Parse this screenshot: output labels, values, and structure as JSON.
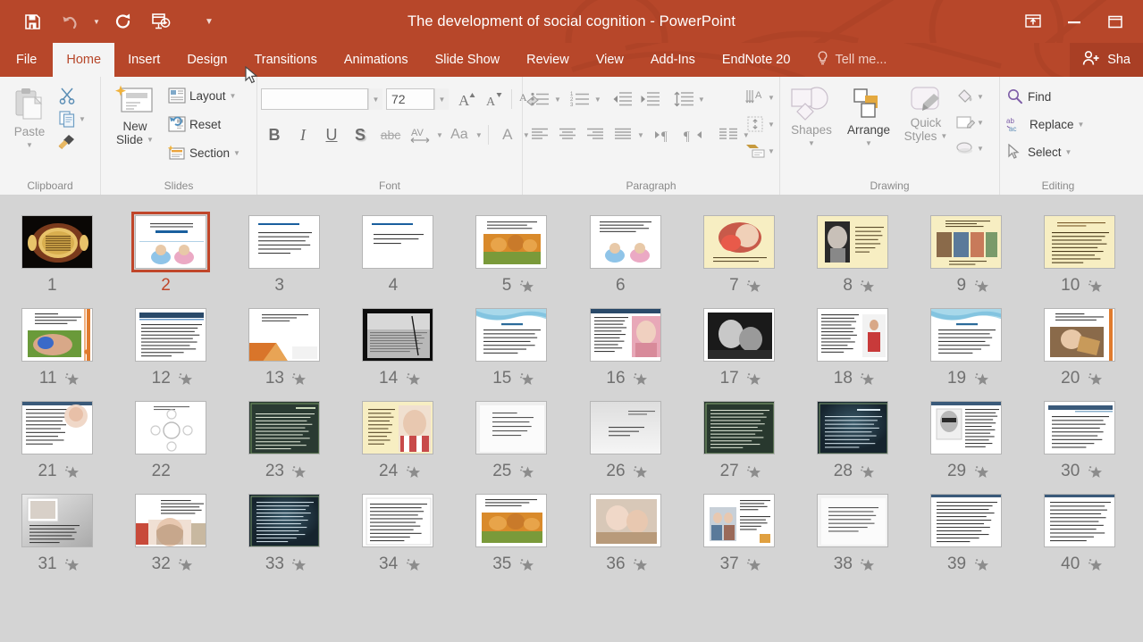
{
  "window": {
    "title": "The development of social cognition - PowerPoint",
    "accent_color": "#b7472a",
    "quick_access": [
      {
        "name": "save-icon",
        "label": "Save"
      },
      {
        "name": "undo-icon",
        "label": "Undo"
      },
      {
        "name": "redo-icon",
        "label": "Redo"
      },
      {
        "name": "start-presentation-icon",
        "label": "Start From Beginning"
      },
      {
        "name": "customize-quick-access-icon",
        "label": "Customize Quick Access Toolbar"
      }
    ],
    "controls": [
      {
        "name": "ribbon-display-options-icon",
        "label": "Ribbon Display Options"
      },
      {
        "name": "minimize-icon",
        "label": "Minimize"
      },
      {
        "name": "restore-icon",
        "label": "Restore Down"
      }
    ]
  },
  "tabs": [
    {
      "label": "File",
      "active": false
    },
    {
      "label": "Home",
      "active": true
    },
    {
      "label": "Insert",
      "active": false
    },
    {
      "label": "Design",
      "active": false
    },
    {
      "label": "Transitions",
      "active": false
    },
    {
      "label": "Animations",
      "active": false
    },
    {
      "label": "Slide Show",
      "active": false
    },
    {
      "label": "Review",
      "active": false
    },
    {
      "label": "View",
      "active": false
    },
    {
      "label": "Add-Ins",
      "active": false
    },
    {
      "label": "EndNote 20",
      "active": false
    }
  ],
  "tell_me": {
    "label": "Tell me...",
    "icon": "lightbulb-icon"
  },
  "share": {
    "label": "Sha",
    "icon": "share-person-icon"
  },
  "ribbon": {
    "clipboard": {
      "label": "Clipboard",
      "paste_label": "Paste",
      "cut_label": "Cut",
      "copy_label": "Copy",
      "format_painter_label": "Format Painter"
    },
    "slides": {
      "label": "Slides",
      "new_slide_label": "New\nSlide",
      "new_slide_line1": "New",
      "new_slide_line2": "Slide",
      "layout_label": "Layout",
      "reset_label": "Reset",
      "section_label": "Section"
    },
    "font": {
      "label": "Font",
      "font_name_value": "",
      "font_name_placeholder": "",
      "font_size_value": "72",
      "increase_font_label": "A",
      "decrease_font_label": "A",
      "clear_formatting_label": "A",
      "bold_label": "B",
      "italic_label": "I",
      "underline_label": "U",
      "shadow_label": "S",
      "strikethrough_label": "abc",
      "character_spacing_label": "AV",
      "change_case_label": "Aa",
      "font_color_label": "A"
    },
    "paragraph": {
      "label": "Paragraph",
      "bullets_label": "Bullets",
      "numbering_label": "Numbering",
      "decrease_indent_label": "Decrease List Level",
      "increase_indent_label": "Increase List Level",
      "line_spacing_label": "Line Spacing",
      "align_left_label": "Align Left",
      "center_label": "Center",
      "align_right_label": "Align Right",
      "justify_label": "Justify",
      "ltr_label": "Left-to-Right",
      "rtl_label": "Right-to-Left",
      "columns_label": "Columns",
      "text_direction_label": "Text Direction",
      "align_text_label": "Align Text",
      "smartart_label": "Convert to SmartArt"
    },
    "drawing": {
      "label": "Drawing",
      "shapes_label": "Shapes",
      "arrange_label": "Arrange",
      "quick_styles_line1": "Quick",
      "quick_styles_line2": "Styles",
      "shape_fill_label": "Shape Fill",
      "shape_outline_label": "Shape Outline",
      "shape_effects_label": "Shape Effects"
    },
    "editing": {
      "label": "Editing",
      "find_label": "Find",
      "replace_label": "Replace",
      "select_label": "Select"
    }
  },
  "slides_panel": {
    "selected_slide": 2,
    "background_color": "#d4d4d4",
    "selection_color": "#c0462a",
    "columns": 10,
    "slides": [
      {
        "n": "1",
        "animated": false,
        "style": "calligraphy-dark"
      },
      {
        "n": "2",
        "animated": false,
        "style": "title-babies",
        "selected": true
      },
      {
        "n": "3",
        "animated": false,
        "style": "text-white"
      },
      {
        "n": "4",
        "animated": false,
        "style": "text-white-short"
      },
      {
        "n": "5",
        "animated": true,
        "style": "text-photo-orange"
      },
      {
        "n": "6",
        "animated": false,
        "style": "text-babies"
      },
      {
        "n": "7",
        "animated": true,
        "style": "cream-oval-photo"
      },
      {
        "n": "8",
        "animated": true,
        "style": "cream-bw-photo"
      },
      {
        "n": "9",
        "animated": true,
        "style": "cream-collage"
      },
      {
        "n": "10",
        "animated": true,
        "style": "cream-text"
      },
      {
        "n": "11",
        "animated": true,
        "style": "orange-edge-photo"
      },
      {
        "n": "12",
        "animated": true,
        "style": "dark-header-text"
      },
      {
        "n": "13",
        "animated": true,
        "style": "orange-geometric"
      },
      {
        "n": "14",
        "animated": true,
        "style": "bw-full-photo"
      },
      {
        "n": "15",
        "animated": true,
        "style": "blue-wave-text"
      },
      {
        "n": "16",
        "animated": true,
        "style": "text-pink-photo"
      },
      {
        "n": "17",
        "animated": true,
        "style": "bw-photo-full"
      },
      {
        "n": "18",
        "animated": true,
        "style": "text-red-figure"
      },
      {
        "n": "19",
        "animated": true,
        "style": "blue-wave-text"
      },
      {
        "n": "20",
        "animated": true,
        "style": "orange-edge-photo2"
      },
      {
        "n": "21",
        "animated": true,
        "style": "text-circle-photo"
      },
      {
        "n": "22",
        "animated": false,
        "style": "diagram-light"
      },
      {
        "n": "23",
        "animated": true,
        "style": "dark-green-text"
      },
      {
        "n": "24",
        "animated": true,
        "style": "cream-child-photo"
      },
      {
        "n": "25",
        "animated": true,
        "style": "gray-text"
      },
      {
        "n": "26",
        "animated": true,
        "style": "gray-gradient"
      },
      {
        "n": "27",
        "animated": true,
        "style": "dark-green-text2"
      },
      {
        "n": "28",
        "animated": true,
        "style": "dark-teal-text"
      },
      {
        "n": "29",
        "animated": true,
        "style": "bw-portrait-text"
      },
      {
        "n": "30",
        "animated": true,
        "style": "header-band-text"
      },
      {
        "n": "31",
        "animated": true,
        "style": "gray-photo-text"
      },
      {
        "n": "32",
        "animated": true,
        "style": "child-photo-text"
      },
      {
        "n": "33",
        "animated": true,
        "style": "dark-teal-text2"
      },
      {
        "n": "34",
        "animated": true,
        "style": "text-white-box"
      },
      {
        "n": "35",
        "animated": true,
        "style": "orange-photo-text"
      },
      {
        "n": "36",
        "animated": true,
        "style": "family-photo"
      },
      {
        "n": "37",
        "animated": true,
        "style": "people-photo-text"
      },
      {
        "n": "38",
        "animated": true,
        "style": "gray-plain-text"
      },
      {
        "n": "39",
        "animated": true,
        "style": "text-lines-white"
      },
      {
        "n": "40",
        "animated": true,
        "style": "text-lines-white2"
      }
    ]
  }
}
